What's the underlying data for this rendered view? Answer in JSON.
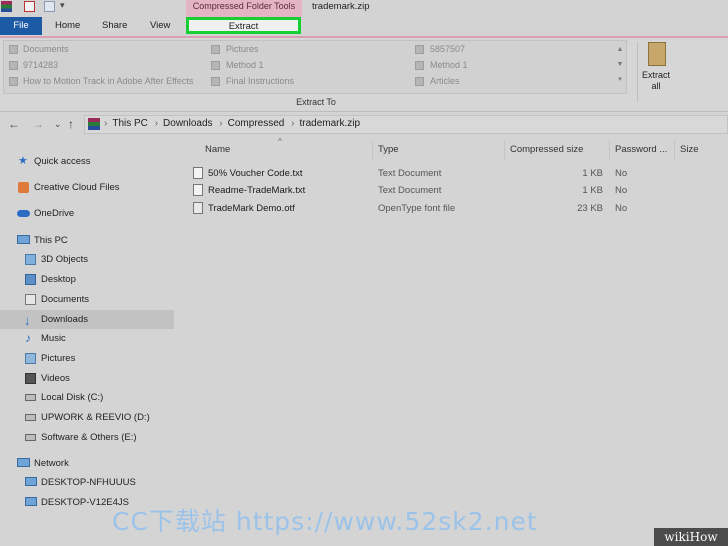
{
  "window": {
    "title": "trademark.zip",
    "context_tab_group": "Compressed Folder Tools"
  },
  "ribbon_tabs": {
    "file": "File",
    "home": "Home",
    "share": "Share",
    "view": "View",
    "extract": "Extract"
  },
  "gallery": {
    "items": [
      "Documents",
      "9714283",
      "How to Motion Track in Adobe After Effects",
      "Pictures",
      "Method 1",
      "Final Instructions",
      "5857507",
      "Method 1",
      "Articles"
    ],
    "group_label": "Extract To"
  },
  "extract_all": {
    "label_line1": "Extract",
    "label_line2": "all"
  },
  "address": {
    "crumbs": [
      "This PC",
      "Downloads",
      "Compressed",
      "trademark.zip"
    ]
  },
  "nav_pane": {
    "quick_access": "Quick access",
    "creative_cloud": "Creative Cloud Files",
    "onedrive": "OneDrive",
    "this_pc": "This PC",
    "objects3d": "3D Objects",
    "desktop": "Desktop",
    "documents": "Documents",
    "downloads": "Downloads",
    "music": "Music",
    "pictures": "Pictures",
    "videos": "Videos",
    "local_disk": "Local Disk (C:)",
    "upwork": "UPWORK & REEVIO (D:)",
    "software": "Software & Others (E:)",
    "network": "Network",
    "desktop_nfhuuus": "DESKTOP-NFHUUUS",
    "desktop_v12e4js": "DESKTOP-V12E4JS"
  },
  "columns": {
    "name": "Name",
    "type": "Type",
    "compressed_size": "Compressed size",
    "password": "Password ...",
    "size": "Size"
  },
  "files": [
    {
      "name": "50% Voucher Code.txt",
      "type": "Text Document",
      "compressed_size": "1 KB",
      "password": "No"
    },
    {
      "name": "Readme-TradeMark.txt",
      "type": "Text Document",
      "compressed_size": "1 KB",
      "password": "No"
    },
    {
      "name": "TradeMark Demo.otf",
      "type": "OpenType font file",
      "compressed_size": "23 KB",
      "password": "No"
    }
  ],
  "watermark": {
    "site": "CC下载站 https://www.52sk2.net",
    "brand": "wikiHow"
  },
  "colors": {
    "file_tab": "#1c5aa6",
    "context_band": "#e2b4c4",
    "highlight_box": "#15d030",
    "selection": "#c2c2c2"
  }
}
